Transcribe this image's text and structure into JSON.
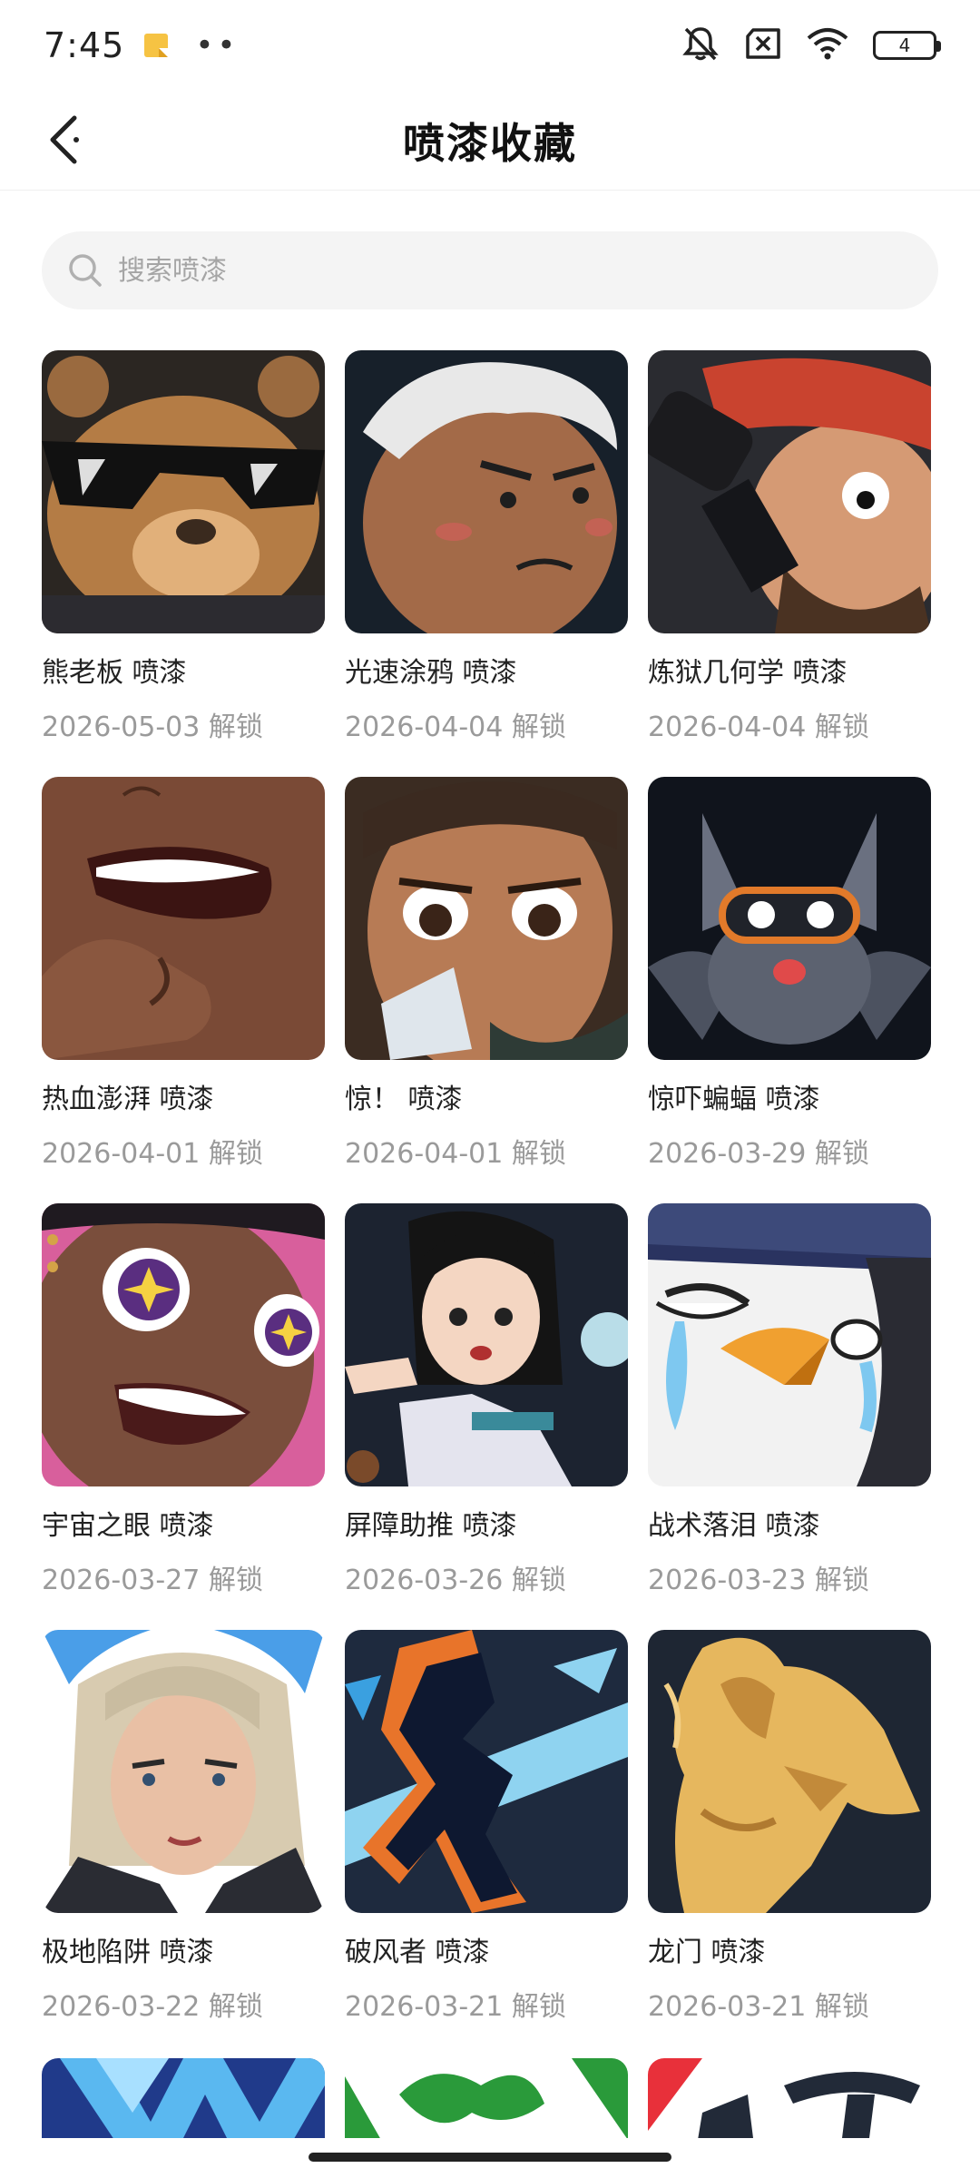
{
  "status": {
    "time": "7:45",
    "battery_level": "4",
    "icons": [
      "notification-note-icon",
      "more-dots-icon",
      "mute-icon",
      "sim-off-icon",
      "wifi-icon",
      "battery-icon"
    ]
  },
  "header": {
    "title": "喷漆收藏"
  },
  "search": {
    "placeholder": "搜索喷漆"
  },
  "sprays": [
    {
      "name": "熊老板 喷漆",
      "unlock": "2026-05-03 解锁"
    },
    {
      "name": "光速涂鸦 喷漆",
      "unlock": "2026-04-04 解锁"
    },
    {
      "name": "炼狱几何学 喷漆",
      "unlock": "2026-04-04 解锁"
    },
    {
      "name": "热血澎湃 喷漆",
      "unlock": "2026-04-01 解锁"
    },
    {
      "name": "惊！ 喷漆",
      "unlock": "2026-04-01 解锁"
    },
    {
      "name": "惊吓蝙蝠 喷漆",
      "unlock": "2026-03-29 解锁"
    },
    {
      "name": "宇宙之眼 喷漆",
      "unlock": "2026-03-27 解锁"
    },
    {
      "name": "屏障助推 喷漆",
      "unlock": "2026-03-26 解锁"
    },
    {
      "name": "战术落泪 喷漆",
      "unlock": "2026-03-23 解锁"
    },
    {
      "name": "极地陷阱 喷漆",
      "unlock": "2026-03-22 解锁"
    },
    {
      "name": "破风者 喷漆",
      "unlock": "2026-03-21 解锁"
    },
    {
      "name": "龙门 喷漆",
      "unlock": "2026-03-21 解锁"
    }
  ]
}
